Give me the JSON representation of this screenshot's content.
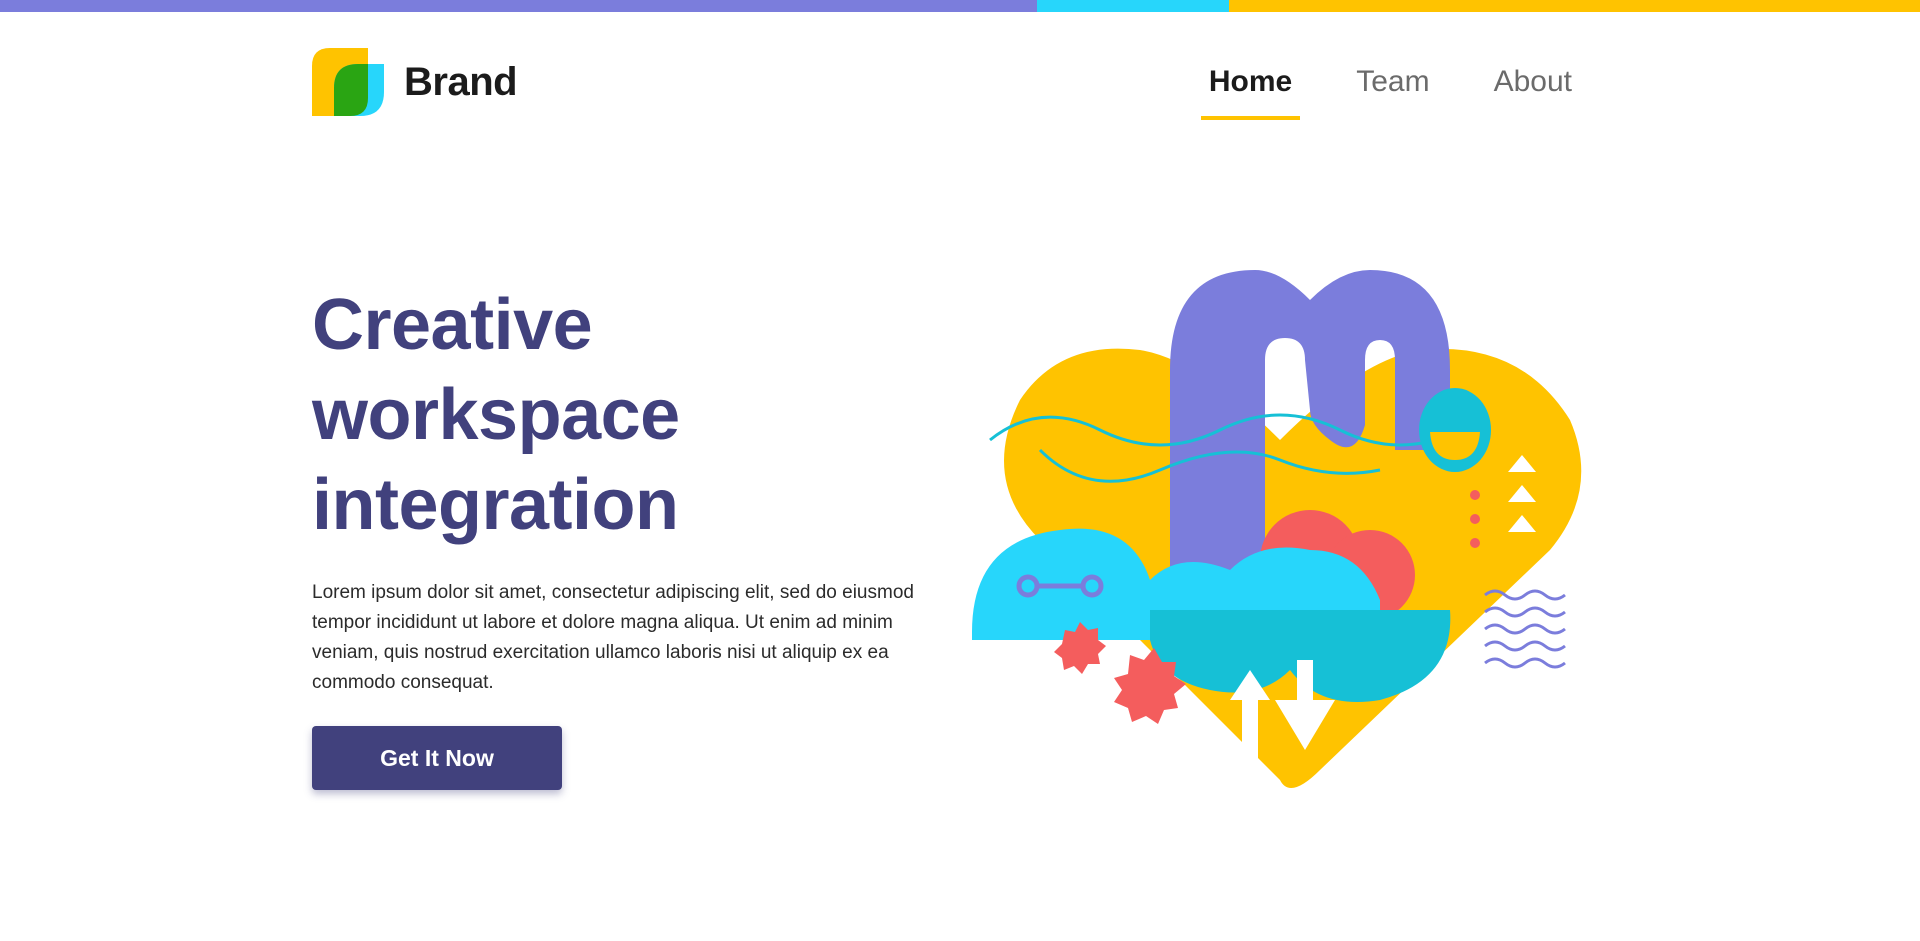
{
  "brand": {
    "name": "Brand"
  },
  "nav": {
    "items": [
      {
        "label": "Home",
        "active": true
      },
      {
        "label": "Team",
        "active": false
      },
      {
        "label": "About",
        "active": false
      }
    ]
  },
  "hero": {
    "title_lines": [
      "Creative",
      "workspace",
      "integration"
    ],
    "description": "Lorem ipsum dolor sit amet, consectetur adipiscing elit, sed do eiusmod tempor incididunt ut labore et dolore magna aliqua. Ut enim ad minim veniam, quis nostrud exercitation ullamco laboris nisi ut aliquip ex ea commodo consequat.",
    "cta_label": "Get It Now"
  },
  "colors": {
    "purple": "#7b7ddc",
    "cyan": "#27d6fb",
    "yellow": "#ffc300",
    "navy": "#41417d",
    "coral": "#f45d5d",
    "teal": "#16c0d6",
    "green": "#2aa513"
  },
  "icons": {
    "logo": "brand-logo-icon",
    "illustration": "hero-illustration"
  }
}
